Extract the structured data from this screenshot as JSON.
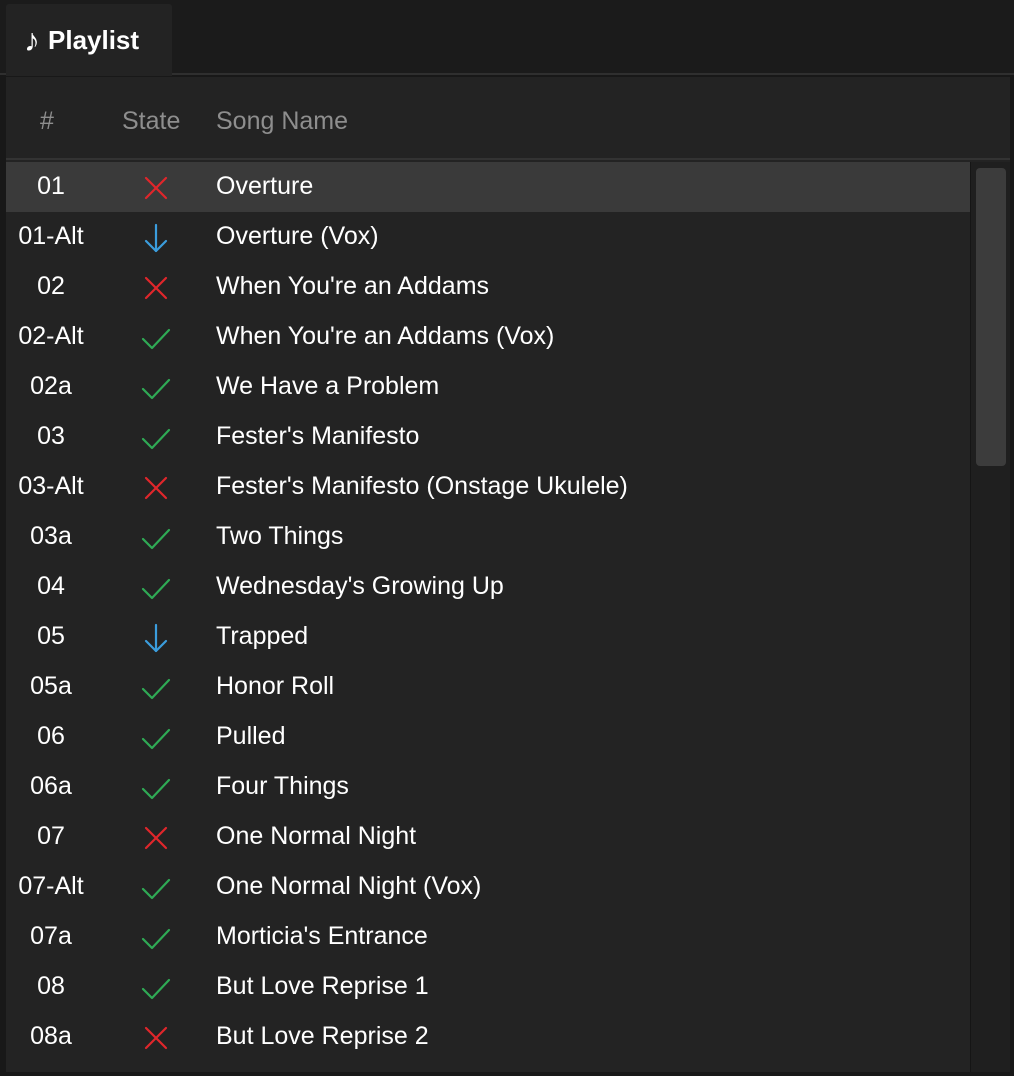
{
  "tab": {
    "icon": "music-note-icon",
    "glyph": "♪",
    "label": "Playlist"
  },
  "header": {
    "num": "#",
    "state": "State",
    "name": "Song Name"
  },
  "colors": {
    "error": "#e0262b",
    "downloading": "#3b9ddd",
    "ok": "#2faa55"
  },
  "rows": [
    {
      "num": "01",
      "state": "error",
      "name": "Overture",
      "selected": true
    },
    {
      "num": "01-Alt",
      "state": "downloading",
      "name": "Overture (Vox)"
    },
    {
      "num": "02",
      "state": "error",
      "name": "When You're an Addams"
    },
    {
      "num": "02-Alt",
      "state": "ok",
      "name": "When You're an Addams (Vox)"
    },
    {
      "num": "02a",
      "state": "ok",
      "name": "We Have a Problem"
    },
    {
      "num": "03",
      "state": "ok",
      "name": "Fester's Manifesto"
    },
    {
      "num": "03-Alt",
      "state": "error",
      "name": "Fester's Manifesto (Onstage Ukulele)"
    },
    {
      "num": "03a",
      "state": "ok",
      "name": "Two Things"
    },
    {
      "num": "04",
      "state": "ok",
      "name": "Wednesday's Growing Up"
    },
    {
      "num": "05",
      "state": "downloading",
      "name": "Trapped"
    },
    {
      "num": "05a",
      "state": "ok",
      "name": "Honor Roll"
    },
    {
      "num": "06",
      "state": "ok",
      "name": "Pulled"
    },
    {
      "num": "06a",
      "state": "ok",
      "name": "Four Things"
    },
    {
      "num": "07",
      "state": "error",
      "name": "One Normal Night"
    },
    {
      "num": "07-Alt",
      "state": "ok",
      "name": "One Normal Night (Vox)"
    },
    {
      "num": "07a",
      "state": "ok",
      "name": "Morticia's Entrance"
    },
    {
      "num": "08",
      "state": "ok",
      "name": "But Love Reprise 1"
    },
    {
      "num": "08a",
      "state": "error",
      "name": "But Love Reprise 2"
    }
  ]
}
